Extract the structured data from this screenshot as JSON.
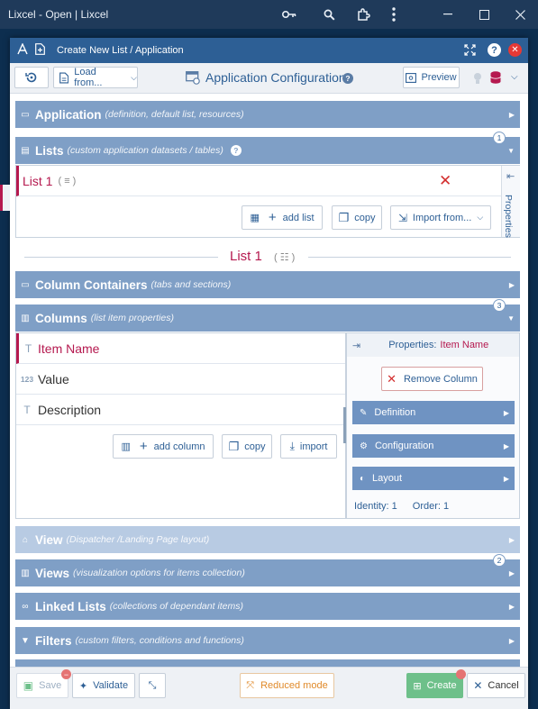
{
  "window": {
    "title": "Lixcel - Open | Lixcel"
  },
  "dialog": {
    "title": "Create New List / Application"
  },
  "toolbar": {
    "load_from": "Load from...",
    "heading": "Application Configuration",
    "preview": "Preview"
  },
  "sections": {
    "application": {
      "name": "Application",
      "desc": "(definition, default list, resources)"
    },
    "lists": {
      "name": "Lists",
      "desc": "(custom application datasets / tables)",
      "badge": "1"
    },
    "column_containers": {
      "name": "Column Containers",
      "desc": "(tabs and sections)"
    },
    "columns": {
      "name": "Columns",
      "desc": "(list item properties)",
      "badge": "3"
    },
    "view": {
      "name": "View",
      "desc": "(Dispatcher /Landing Page layout)"
    },
    "views": {
      "name": "Views",
      "desc": "(visualization options for items collection)",
      "badge": "2"
    },
    "linked_lists": {
      "name": "Linked Lists",
      "desc": "(collections of dependant items)"
    },
    "filters": {
      "name": "Filters",
      "desc": "(custom filters, conditions and functions)"
    }
  },
  "lists_panel": {
    "list_item": "List 1",
    "list_item_suffix": "( ≡ )",
    "add_list": "add list",
    "copy": "copy",
    "import_from": "Import from...",
    "properties_tab": "Properties"
  },
  "list_heading": {
    "name": "List 1",
    "suffix": "( ☷ )"
  },
  "columns_panel": {
    "rows": [
      {
        "type": "T",
        "name": "Item Name"
      },
      {
        "type": "123",
        "name": "Value"
      },
      {
        "type": "T",
        "name": "Description"
      }
    ],
    "add_column": "add column",
    "copy": "copy",
    "import": "import"
  },
  "column_properties": {
    "label": "Properties:",
    "selected": "Item Name",
    "remove": "Remove Column",
    "groups": [
      "Definition",
      "Configuration",
      "Layout"
    ],
    "identity_label": "Identity:",
    "identity": "1",
    "order_label": "Order:",
    "order": "1"
  },
  "footer": {
    "save": "Save",
    "validate": "Validate",
    "reduced_mode": "Reduced mode",
    "create": "Create",
    "cancel": "Cancel"
  },
  "colors": {
    "accent": "#2d5f95",
    "section": "#7f9fc6",
    "selected_text": "#b5194f",
    "remove_red": "#d32f2f",
    "create_green": "#6ec08a",
    "reduced_orange": "#e08a2a"
  }
}
